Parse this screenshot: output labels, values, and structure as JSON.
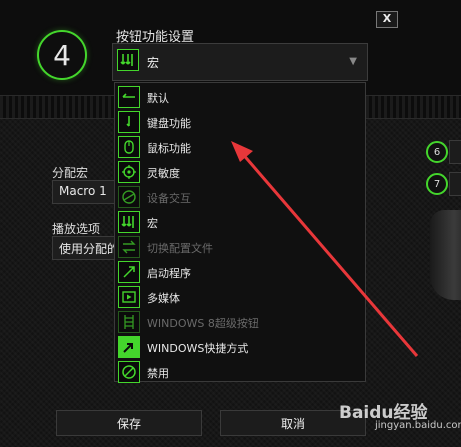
{
  "key_number": "4",
  "panel": {
    "title": "按钮功能设置",
    "close_label": "X",
    "selected": {
      "label": "宏",
      "icon": "macro-icon"
    }
  },
  "function_options": [
    {
      "label": "默认",
      "icon": "default-icon",
      "enabled": true
    },
    {
      "label": "键盘功能",
      "icon": "keyboard-icon",
      "enabled": true
    },
    {
      "label": "鼠标功能",
      "icon": "mouse-icon",
      "enabled": true
    },
    {
      "label": "灵敏度",
      "icon": "sensitivity-icon",
      "enabled": true
    },
    {
      "label": "设备交互",
      "icon": "device-interaction-icon",
      "enabled": false
    },
    {
      "label": "宏",
      "icon": "macro-icon",
      "enabled": true
    },
    {
      "label": "切换配置文件",
      "icon": "switch-profile-icon",
      "enabled": false
    },
    {
      "label": "启动程序",
      "icon": "launch-program-icon",
      "enabled": true
    },
    {
      "label": "多媒体",
      "icon": "multimedia-icon",
      "enabled": true
    },
    {
      "label": "WINDOWS 8超级按钮",
      "icon": "windows8-charms-icon",
      "enabled": false
    },
    {
      "label": "WINDOWS快捷方式",
      "icon": "windows-shortcut-icon",
      "enabled": true
    },
    {
      "label": "禁用",
      "icon": "disable-icon",
      "enabled": true
    }
  ],
  "assign_macro": {
    "label": "分配宏",
    "value": "Macro 1"
  },
  "playback": {
    "label": "播放选项",
    "value": "使用分配的"
  },
  "right_buttons": [
    "6",
    "7"
  ],
  "footer": {
    "save_label": "保存",
    "cancel_label": "取消"
  },
  "watermark": {
    "brand": "Baidu经验",
    "url": "jingyan.baidu.com"
  },
  "colors": {
    "accent": "#44d62c",
    "annotation_arrow": "#e8373a"
  }
}
